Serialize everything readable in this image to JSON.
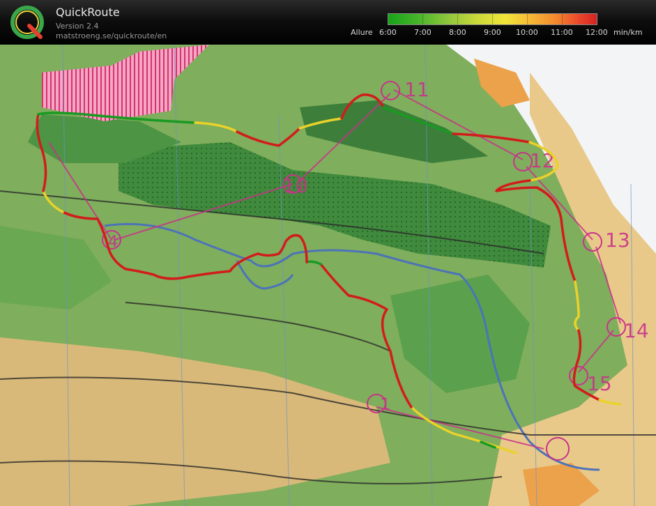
{
  "app": {
    "name": "QuickRoute",
    "version": "Version 2.4",
    "url": "matstroeng.se/quickroute/en"
  },
  "pace_scale": {
    "title": "Allure",
    "ticks": [
      "6:00",
      "7:00",
      "8:00",
      "9:00",
      "10:00",
      "11:00",
      "12:00"
    ],
    "unit": "min/km",
    "color_slow": "#d42222",
    "color_fast": "#17a31a"
  },
  "map": {
    "control_labels": [
      "1",
      "4",
      "10",
      "11",
      "12",
      "13",
      "14",
      "15"
    ],
    "colors": {
      "forest": "#3f8a3c",
      "open": "#e9c98a",
      "water": "#4c73b8",
      "restricted": "#d6336b",
      "course": "#c8338a",
      "route_slow": "#d21c1c",
      "route_medium": "#e9d22a",
      "route_fast": "#1a9a22"
    }
  }
}
